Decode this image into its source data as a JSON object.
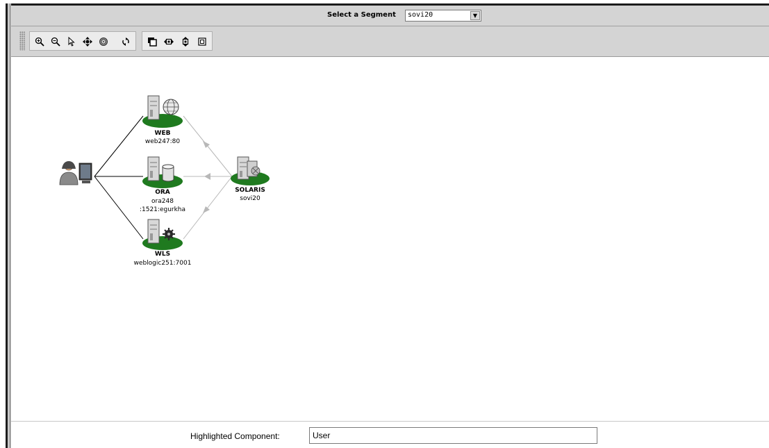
{
  "segment": {
    "label": "Select a Segment",
    "selected": "sovi20"
  },
  "toolbar": {
    "buttons": [
      {
        "name": "zoom-in-icon"
      },
      {
        "name": "zoom-out-icon"
      },
      {
        "name": "select-pointer-icon"
      },
      {
        "name": "pan-icon"
      },
      {
        "name": "fit-icon"
      },
      {
        "name": "refresh-icon"
      },
      {
        "name": "overview-icon"
      },
      {
        "name": "horizontal-layout-icon"
      },
      {
        "name": "vertical-layout-icon"
      },
      {
        "name": "layout-icon"
      }
    ]
  },
  "topology": {
    "user": {
      "name": "User"
    },
    "nodes": [
      {
        "id": "web",
        "title": "WEB",
        "lines": [
          "web247:80"
        ],
        "icon": "web-server-icon"
      },
      {
        "id": "ora",
        "title": "ORA",
        "lines": [
          "ora248",
          ":1521:egurkha"
        ],
        "icon": "database-server-icon"
      },
      {
        "id": "wls",
        "title": "WLS",
        "lines": [
          "weblogic251:7001"
        ],
        "icon": "weblogic-server-icon"
      },
      {
        "id": "solaris",
        "title": "SOLARIS",
        "lines": [
          "sovi20"
        ],
        "icon": "solaris-host-icon"
      }
    ],
    "colors": {
      "node_base": "#1f7a1f",
      "link": "#000000",
      "dependency": "#b8b8b8"
    }
  },
  "footer": {
    "highlighted_label": "Highlighted Component:",
    "highlighted_value": "User"
  }
}
